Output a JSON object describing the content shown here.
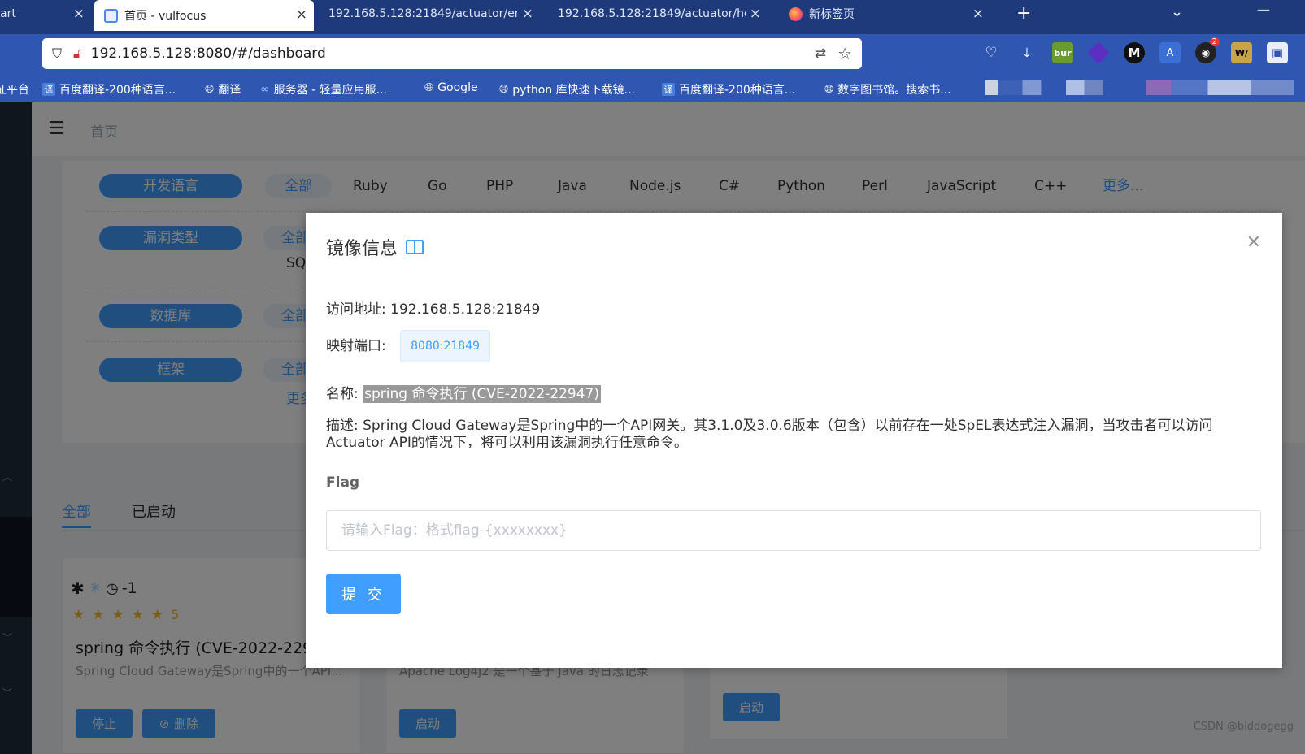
{
  "browser": {
    "tabs": [
      {
        "title": "art",
        "active": false
      },
      {
        "title": "首页 - vulfocus",
        "active": true
      },
      {
        "title": "192.168.5.128:21849/actuator/en",
        "active": false
      },
      {
        "title": "192.168.5.128:21849/actuator/he",
        "active": false
      },
      {
        "title": "新标签页",
        "active": false
      }
    ],
    "new_tab_label": "+",
    "url": "192.168.5.128:8080/#/dashboard",
    "bookmarks": [
      {
        "label": "证平台"
      },
      {
        "label": "百度翻译-200种语言..."
      },
      {
        "label": "翻译"
      },
      {
        "label": "服务器 - 轻量应用服..."
      },
      {
        "label": "Google"
      },
      {
        "label": "python 库快速下载镜..."
      },
      {
        "label": "百度翻译-200种语言..."
      },
      {
        "label": "数字图书馆。搜索书..."
      }
    ],
    "extensions": [
      {
        "label": "bur"
      },
      {
        "label": "2"
      },
      {
        "label": "W/"
      }
    ]
  },
  "page": {
    "breadcrumb": "首页",
    "filters": {
      "language_label": "开发语言",
      "languages": [
        "全部",
        "Ruby",
        "Go",
        "PHP",
        "Java",
        "Node.js",
        "C#",
        "Python",
        "Perl",
        "JavaScript",
        "C++",
        "更多..."
      ],
      "vuln_type_label": "漏洞类型",
      "vuln_type_first": "全部",
      "vuln_type_second": "SQ",
      "database_label": "数据库",
      "database_first": "全部",
      "framework_label": "框架",
      "framework_first": "全部",
      "framework_more": "更多"
    },
    "main_tabs": [
      "全部",
      "已启动"
    ],
    "cards": [
      {
        "clock_value": "-1",
        "rating": "5",
        "name": "spring 命令执行 (CVE-2022-229",
        "desc": "Spring Cloud Gateway是Spring中的一个API...",
        "buttons": [
          "停止",
          "删除"
        ]
      },
      {
        "desc": "Apache Log4j2 是一个基于 Java 的日志记录",
        "buttons": [
          "启动"
        ]
      },
      {
        "buttons": [
          "启动"
        ]
      }
    ]
  },
  "dialog": {
    "title": "镜像信息",
    "access_label": "访问地址: ",
    "access_value": "192.168.5.128:21849",
    "port_label": "映射端口: ",
    "port_value": "8080:21849",
    "name_label": "名称: ",
    "name_value": "spring 命令执行 (CVE-2022-22947)",
    "desc_label": "描述: ",
    "desc_value": "Spring Cloud Gateway是Spring中的一个API网关。其3.1.0及3.0.6版本（包含）以前存在一处SpEL表达式注入漏洞，当攻击者可以访问Actuator API的情况下，将可以利用该漏洞执行任意命令。",
    "flag_label": "Flag",
    "flag_placeholder": "请输入Flag：格式flag-{xxxxxxxx}",
    "flag_value": "",
    "submit_label": "提 交"
  },
  "watermark": "CSDN @biddogegg",
  "colors": {
    "primary": "#409eff",
    "tabbar": "#1e3a7a",
    "navbar": "#2f56b0",
    "sidebar": "#1f2d3d"
  }
}
